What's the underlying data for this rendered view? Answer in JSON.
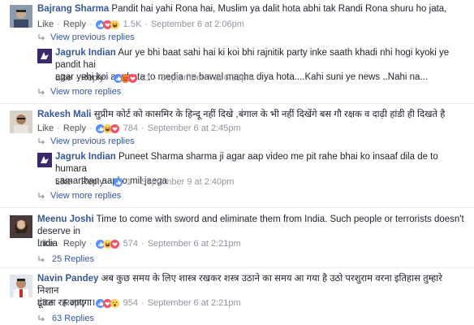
{
  "colors": {
    "link": "#365899",
    "meta": "#90949c",
    "text": "#1d2129",
    "like_blue": "#5890ff",
    "love_red": "#f25268",
    "haha_yellow": "#fcd15b"
  },
  "actions": {
    "like": "Like",
    "reply": "Reply"
  },
  "comments": [
    {
      "author": "Bajrang Sharma",
      "text": "Pandit hai yahi Rona hai, Muslim ya dalit hota abhi tak Randi Rona shuru ho jata,",
      "reactions": [
        "like-reaction",
        "love-reaction",
        "haha-reaction"
      ],
      "count": "1.5K",
      "time": "September 6 at 2:06pm",
      "view_previous": "View previous replies",
      "reply": {
        "author": "Jagruk Indian",
        "text_line1": "Aur ye bhi baat sahi hai ki koi bhi rajnitik party inke saath khadi nhi hogi kyoki ye pandit hai",
        "text_line2": "agar yehi koi aur hota to media ne bawal macha diya hota....Kahi suni ye news ..Nahi na...",
        "count": "21",
        "time": "September 7 at 6:33pm"
      },
      "view_more": "View more replies"
    },
    {
      "author": "Rakesh Mali",
      "text": "सुप्रीम कोर्ट को कासमिर के हिन्दू नहीं दिखे ,बंगाल के भी नहीं दिखेंगे बस गौ रक्षक व दाढ़ी हांडी ही दिखते है",
      "count": "784",
      "time": "September 6 at 2:45pm",
      "view_previous": "View previous replies",
      "reply": {
        "author": "Jagruk Indian",
        "text_line1": "Puneet Sharma sharma ji agar aap video me pit rahe bhai ko insaaf dila de to humara",
        "text_line2": "samarthan aapko mil jaega",
        "count": "1",
        "time": "September 9 at 2:40pm"
      },
      "view_more": "View more replies"
    },
    {
      "author": "Meenu Joshi",
      "text_line1": "Time to come with sword and eliminate them from India. Such people or terrorists doesn't deserve in",
      "text_line2": "India",
      "count": "574",
      "time": "September 6 at 2:21pm",
      "replies": "25 Replies"
    },
    {
      "author": "Navin Pandey",
      "text_line1": "अब कुछ समय के लिए शास्त्र रखकर शस्त्र उठाने का समय आ गया है उठो परशुराम वरना इतिहास तुम्हारे निशान",
      "text_line2": "ढूंढता रह जाएगा।",
      "count": "954",
      "time": "September 6 at 2:21pm",
      "replies": "63 Replies"
    }
  ]
}
